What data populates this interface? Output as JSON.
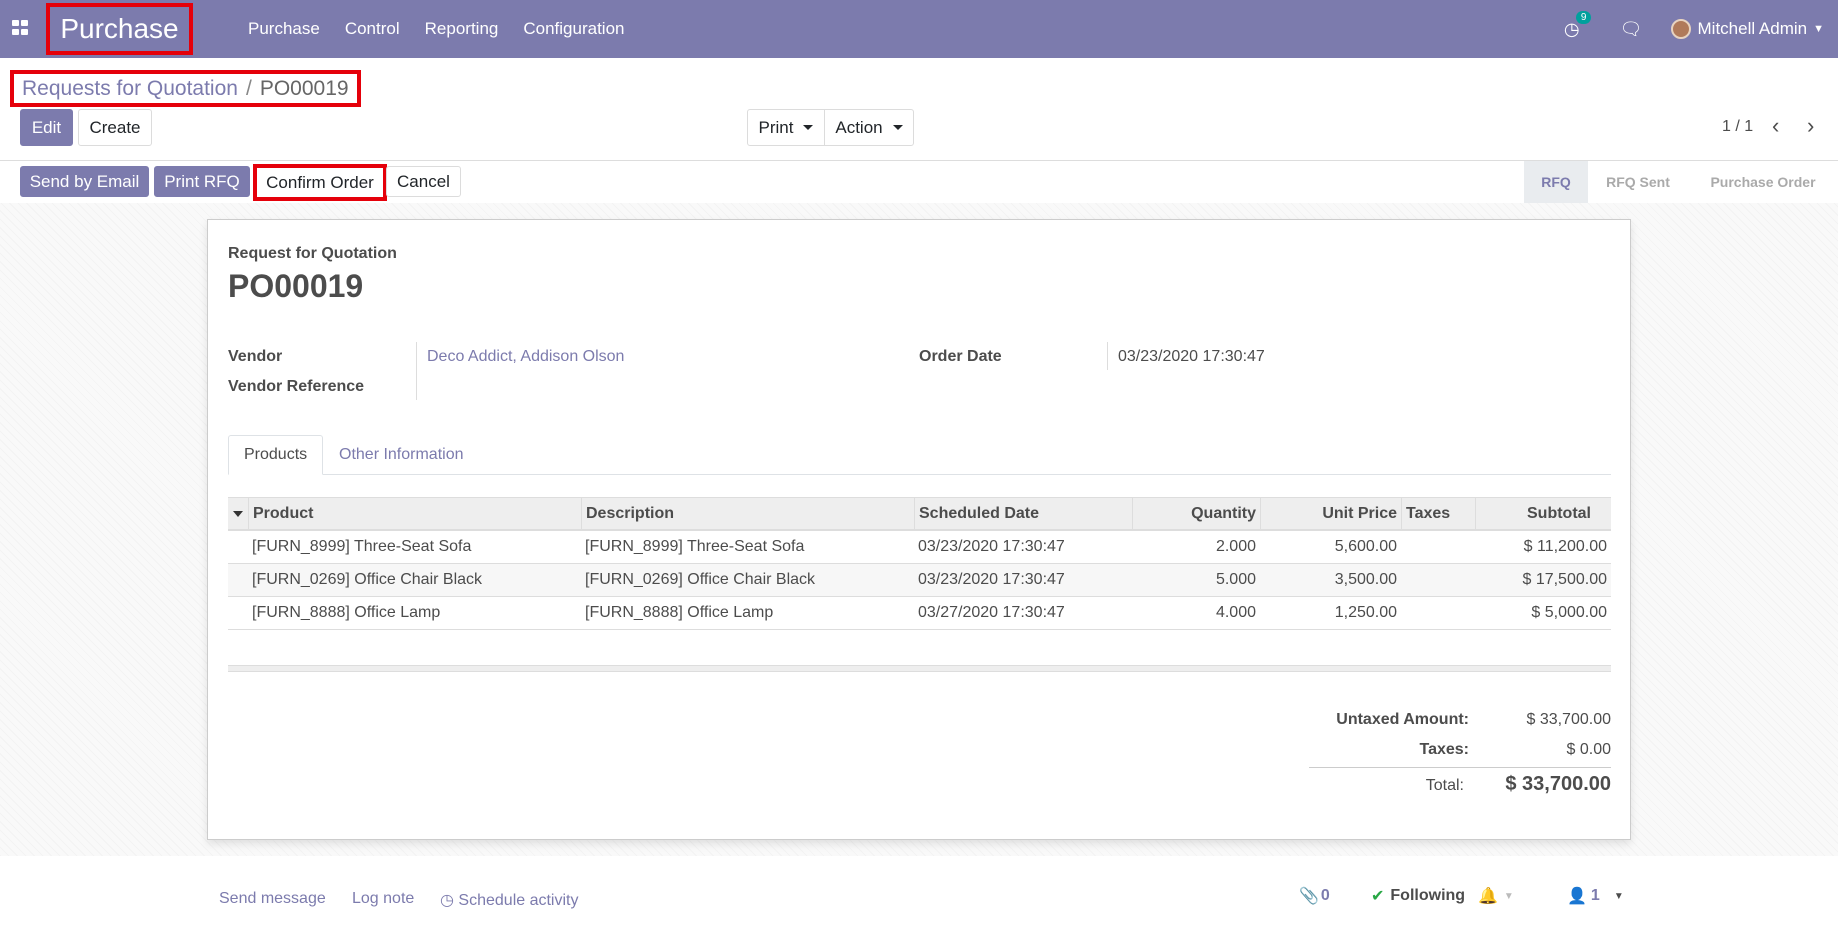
{
  "navbar": {
    "app_title": "Purchase",
    "menu": [
      "Purchase",
      "Control",
      "Reporting",
      "Configuration"
    ],
    "activity_count": "9",
    "user_name": "Mitchell Admin"
  },
  "breadcrumb": {
    "parent": "Requests for Quotation",
    "separator": "/",
    "current": "PO00019"
  },
  "buttons": {
    "edit": "Edit",
    "create": "Create",
    "print": "Print",
    "action": "Action",
    "send_by_email": "Send by Email",
    "print_rfq": "Print RFQ",
    "confirm_order": "Confirm Order",
    "cancel": "Cancel"
  },
  "pager": {
    "value": "1 / 1"
  },
  "stages": [
    "RFQ",
    "RFQ Sent",
    "Purchase Order"
  ],
  "form": {
    "subtitle": "Request for Quotation",
    "title": "PO00019",
    "vendor_label": "Vendor",
    "vendor_value": "Deco Addict, Addison Olson",
    "vendor_ref_label": "Vendor Reference",
    "order_date_label": "Order Date",
    "order_date_value": "03/23/2020 17:30:47"
  },
  "tabs": [
    "Products",
    "Other Information"
  ],
  "table": {
    "headers": [
      "Product",
      "Description",
      "Scheduled Date",
      "Quantity",
      "Unit Price",
      "Taxes",
      "Subtotal"
    ],
    "rows": [
      [
        "[FURN_8999] Three-Seat Sofa",
        "[FURN_8999] Three-Seat Sofa",
        "03/23/2020 17:30:47",
        "2.000",
        "5,600.00",
        "",
        "$ 11,200.00"
      ],
      [
        "[FURN_0269] Office Chair Black",
        "[FURN_0269] Office Chair Black",
        "03/23/2020 17:30:47",
        "5.000",
        "3,500.00",
        "",
        "$ 17,500.00"
      ],
      [
        "[FURN_8888] Office Lamp",
        "[FURN_8888] Office Lamp",
        "03/27/2020 17:30:47",
        "4.000",
        "1,250.00",
        "",
        "$ 5,000.00"
      ]
    ]
  },
  "totals": {
    "untaxed_label": "Untaxed Amount:",
    "untaxed_value": "$ 33,700.00",
    "taxes_label": "Taxes:",
    "taxes_value": "$ 0.00",
    "total_label": "Total:",
    "total_value": "$ 33,700.00"
  },
  "chatter": {
    "send_message": "Send message",
    "log_note": "Log note",
    "schedule_activity": "Schedule activity",
    "attachments_count": "0",
    "following": "Following",
    "followers_count": "1"
  }
}
